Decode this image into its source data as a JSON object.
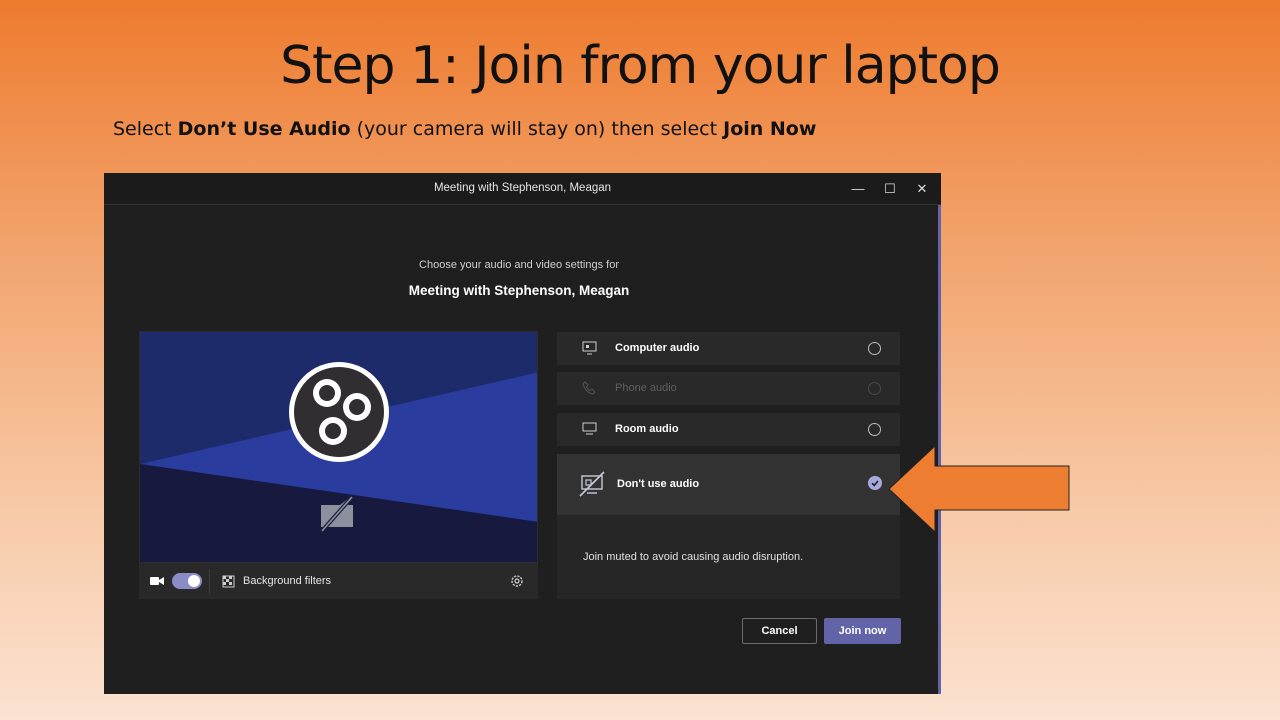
{
  "slide": {
    "title": "Step 1: Join from your laptop",
    "instruction_prefix": "Select ",
    "instruction_bold1": "Don’t Use Audio",
    "instruction_middle": " (your camera will stay on) then select ",
    "instruction_bold2": "Join Now"
  },
  "window": {
    "title": "Meeting with Stephenson, Meagan",
    "controls": {
      "minimize": "—",
      "maximize": "☐",
      "close": "✕"
    }
  },
  "dialog": {
    "subheading": "Choose your audio and video settings for",
    "meeting_name": "Meeting with Stephenson, Meagan"
  },
  "video": {
    "camera_toggle_on": true,
    "background_filters_label": "Background filters"
  },
  "audio_options": [
    {
      "label": "Computer audio",
      "icon": "computer-speaker-icon",
      "state": "unselected"
    },
    {
      "label": "Phone audio",
      "icon": "phone-icon",
      "state": "disabled"
    },
    {
      "label": "Room audio",
      "icon": "monitor-icon",
      "state": "unselected"
    },
    {
      "label": "Don't use audio",
      "icon": "no-audio-icon",
      "state": "selected"
    }
  ],
  "info_text": "Join muted to avoid causing audio disruption.",
  "buttons": {
    "cancel": "Cancel",
    "join": "Join now"
  },
  "colors": {
    "accent": "#6264a7",
    "selected_radio": "#a6a7dc",
    "arrow": "#ed7d31",
    "dialog_bg": "#1f1f1f"
  }
}
